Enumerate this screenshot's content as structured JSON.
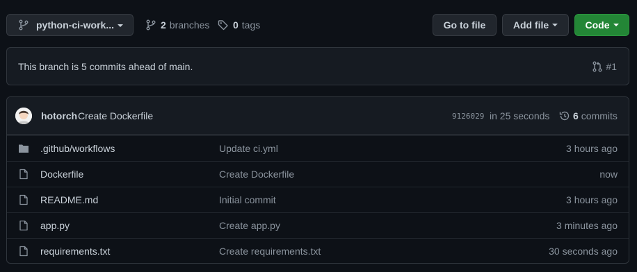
{
  "toolbar": {
    "branch_name": "python-ci-work...",
    "branches_count": "2",
    "branches_label": "branches",
    "tags_count": "0",
    "tags_label": "tags",
    "goto_file_label": "Go to file",
    "add_file_label": "Add file",
    "code_label": "Code"
  },
  "ahead": {
    "message": "This branch is 5 commits ahead of main.",
    "pr_label": "#1"
  },
  "latest_commit": {
    "author": "hotorch",
    "message": "Create Dockerfile",
    "sha": "9126029",
    "time": "in 25 seconds",
    "commits_count": "6",
    "commits_label": "commits"
  },
  "files": [
    {
      "type": "folder",
      "name_prefix": ".github/",
      "name_link": "workflows",
      "commit": "Update ci.yml",
      "age": "3 hours ago"
    },
    {
      "type": "file",
      "name": "Dockerfile",
      "commit": "Create Dockerfile",
      "age": "now"
    },
    {
      "type": "file",
      "name": "README.md",
      "commit": "Initial commit",
      "age": "3 hours ago"
    },
    {
      "type": "file",
      "name": "app.py",
      "commit": "Create app.py",
      "age": "3 minutes ago"
    },
    {
      "type": "file",
      "name": "requirements.txt",
      "commit": "Create requirements.txt",
      "age": "30 seconds ago"
    }
  ],
  "colors": {
    "background": "#0d1117",
    "panel": "#161b22",
    "border": "#30363d",
    "text": "#c9d1d9",
    "muted": "#8b949e",
    "code_button": "#238636",
    "folder_icon": "#8b949e"
  }
}
